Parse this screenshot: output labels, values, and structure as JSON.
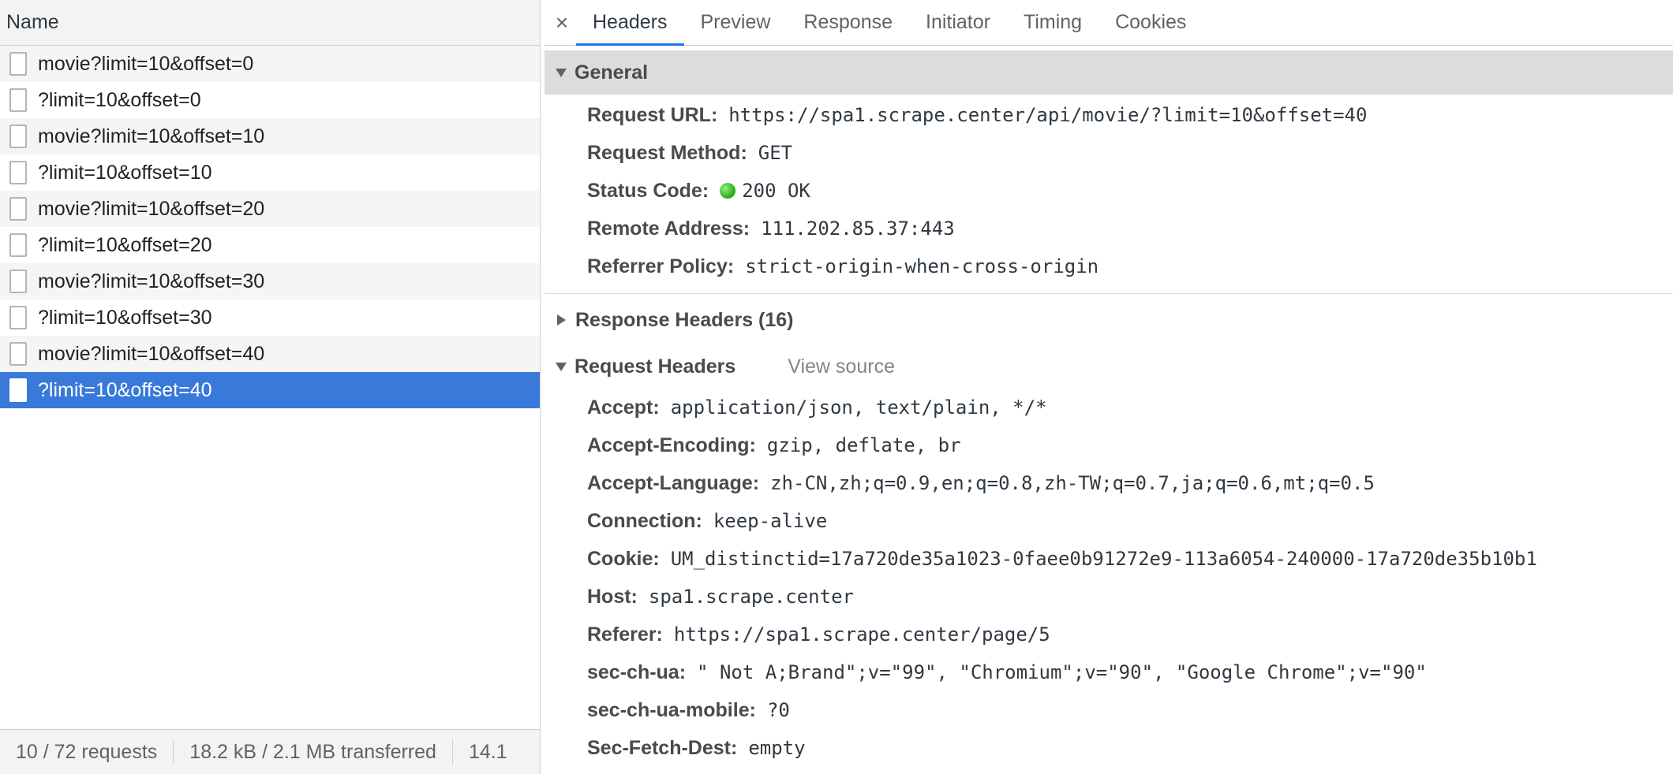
{
  "left_panel": {
    "column_header": "Name",
    "requests": [
      {
        "name": "movie?limit=10&offset=0"
      },
      {
        "name": "?limit=10&offset=0"
      },
      {
        "name": "movie?limit=10&offset=10"
      },
      {
        "name": "?limit=10&offset=10"
      },
      {
        "name": "movie?limit=10&offset=20"
      },
      {
        "name": "?limit=10&offset=20"
      },
      {
        "name": "movie?limit=10&offset=30"
      },
      {
        "name": "?limit=10&offset=30"
      },
      {
        "name": "movie?limit=10&offset=40"
      },
      {
        "name": "?limit=10&offset=40",
        "selected": true
      }
    ],
    "status_bar": {
      "requests": "10 / 72 requests",
      "transferred": "18.2 kB / 2.1 MB transferred",
      "truncated": "14.1"
    }
  },
  "tabs": {
    "close_symbol": "×",
    "items": [
      "Headers",
      "Preview",
      "Response",
      "Initiator",
      "Timing",
      "Cookies"
    ],
    "active": "Headers"
  },
  "general": {
    "title": "General",
    "rows": [
      {
        "key": "Request URL:",
        "value": "https://spa1.scrape.center/api/movie/?limit=10&offset=40"
      },
      {
        "key": "Request Method:",
        "value": "GET"
      },
      {
        "key": "Status Code:",
        "value": "200 OK",
        "status_color": "#36b72a"
      },
      {
        "key": "Remote Address:",
        "value": "111.202.85.37:443"
      },
      {
        "key": "Referrer Policy:",
        "value": "strict-origin-when-cross-origin"
      }
    ]
  },
  "response_headers": {
    "title": "Response Headers (16)",
    "collapsed": true
  },
  "request_headers": {
    "title": "Request Headers",
    "view_source": "View source",
    "rows": [
      {
        "key": "Accept:",
        "value": "application/json, text/plain, */*"
      },
      {
        "key": "Accept-Encoding:",
        "value": "gzip, deflate, br"
      },
      {
        "key": "Accept-Language:",
        "value": "zh-CN,zh;q=0.9,en;q=0.8,zh-TW;q=0.7,ja;q=0.6,mt;q=0.5"
      },
      {
        "key": "Connection:",
        "value": "keep-alive"
      },
      {
        "key": "Cookie:",
        "value": "UM_distinctid=17a720de35a1023-0faee0b91272e9-113a6054-240000-17a720de35b10b1"
      },
      {
        "key": "Host:",
        "value": "spa1.scrape.center"
      },
      {
        "key": "Referer:",
        "value": "https://spa1.scrape.center/page/5"
      },
      {
        "key": "sec-ch-ua:",
        "value": "\" Not A;Brand\";v=\"99\", \"Chromium\";v=\"90\", \"Google Chrome\";v=\"90\""
      },
      {
        "key": "sec-ch-ua-mobile:",
        "value": "?0"
      },
      {
        "key": "Sec-Fetch-Dest:",
        "value": "empty"
      }
    ]
  },
  "colors": {
    "selected_row": "#3879d9",
    "active_tab_underline": "#1a73e8",
    "status_ok": "#36b72a"
  }
}
